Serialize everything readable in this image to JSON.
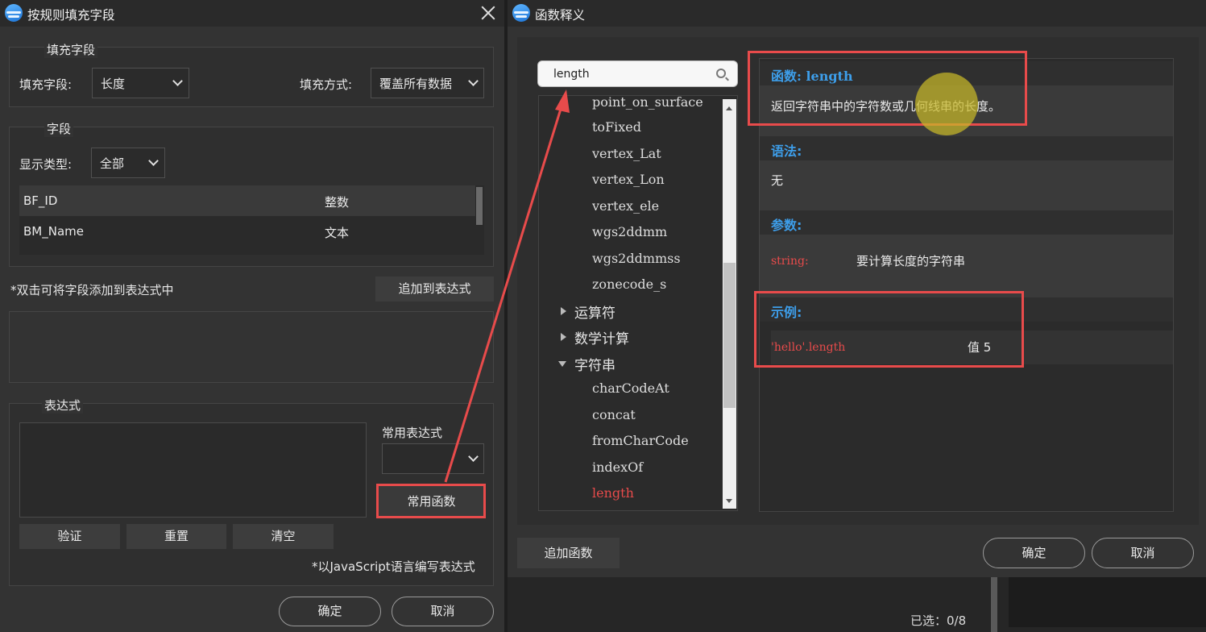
{
  "left_dialog": {
    "title": "按规则填充字段",
    "fill_group": {
      "legend": "填充字段",
      "field_label": "填充字段:",
      "field_value": "长度",
      "mode_label": "填充方式:",
      "mode_value": "覆盖所有数据"
    },
    "field_group": {
      "legend": "字段",
      "display_type_label": "显示类型:",
      "display_type_value": "全部",
      "rows": [
        {
          "name": "BF_ID",
          "type": "整数"
        },
        {
          "name": "BM_Name",
          "type": "文本"
        }
      ]
    },
    "hint": "*双击可将字段添加到表达式中",
    "add_to_expr": "追加到表达式",
    "expr_group": {
      "legend": "表达式",
      "common_expr_label": "常用表达式",
      "common_func_button": "常用函数",
      "validate": "验证",
      "reset": "重置",
      "clear": "清空",
      "js_note": "*以JavaScript语言编写表达式"
    },
    "ok": "确定",
    "cancel": "取消"
  },
  "right_dialog": {
    "title": "函数释义",
    "search_value": "length",
    "tree_items_top": [
      "point_on_surface",
      "toFixed",
      "vertex_Lat",
      "vertex_Lon",
      "vertex_ele",
      "wgs2ddmm",
      "wgs2ddmmss",
      "zonecode_s"
    ],
    "categories": [
      "运算符",
      "数学计算",
      "字符串"
    ],
    "tree_items_string": [
      "charCodeAt",
      "concat",
      "fromCharCode",
      "indexOf",
      "length"
    ],
    "selected_item": "length",
    "func_header": "函数: length",
    "func_desc": "返回字符串中的字符数或几何线串的长度。",
    "syntax_header": "语法:",
    "syntax_value": "无",
    "params_header": "参数:",
    "param_name": "string:",
    "param_desc": "要计算长度的字符串",
    "example_header": "示例:",
    "example_code": "'hello'.length",
    "example_result": "值  5",
    "add_function": "追加函数",
    "ok": "确定",
    "cancel": "取消"
  },
  "status": {
    "selected": "已选：0/8"
  },
  "colors": {
    "accent_blue": "#3d9eea",
    "highlight_red": "#e84b4b",
    "dialog_bg": "#333333"
  }
}
